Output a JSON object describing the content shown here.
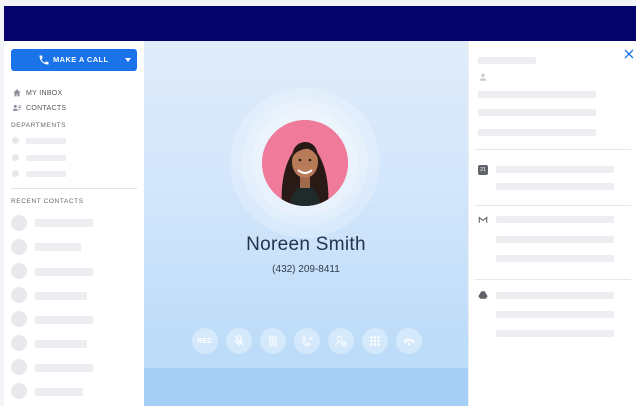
{
  "sidebar": {
    "call_button_label": "MAKE A CALL",
    "nav": [
      {
        "label": "MY INBOX",
        "icon": "home-icon"
      },
      {
        "label": "CONTACTS",
        "icon": "contacts-icon"
      }
    ],
    "departments_label": "DEPARTMENTS",
    "recent_label": "RECENT CONTACTS"
  },
  "call": {
    "contact_name": "Noreen Smith",
    "contact_phone": "(432) 209-8411",
    "rec_label": "REC",
    "controls": [
      "record-button",
      "mute-button",
      "hold-button",
      "transfer-button",
      "add-participant-button",
      "keypad-button",
      "hangup-button"
    ]
  },
  "right_panel": {
    "integrations": [
      "calendar-icon",
      "gmail-icon",
      "drive-icon"
    ],
    "calendar_day": "21"
  },
  "colors": {
    "topbar": "#03036b",
    "accent": "#1a73e8",
    "avatar_ring": "#f07a9a"
  }
}
